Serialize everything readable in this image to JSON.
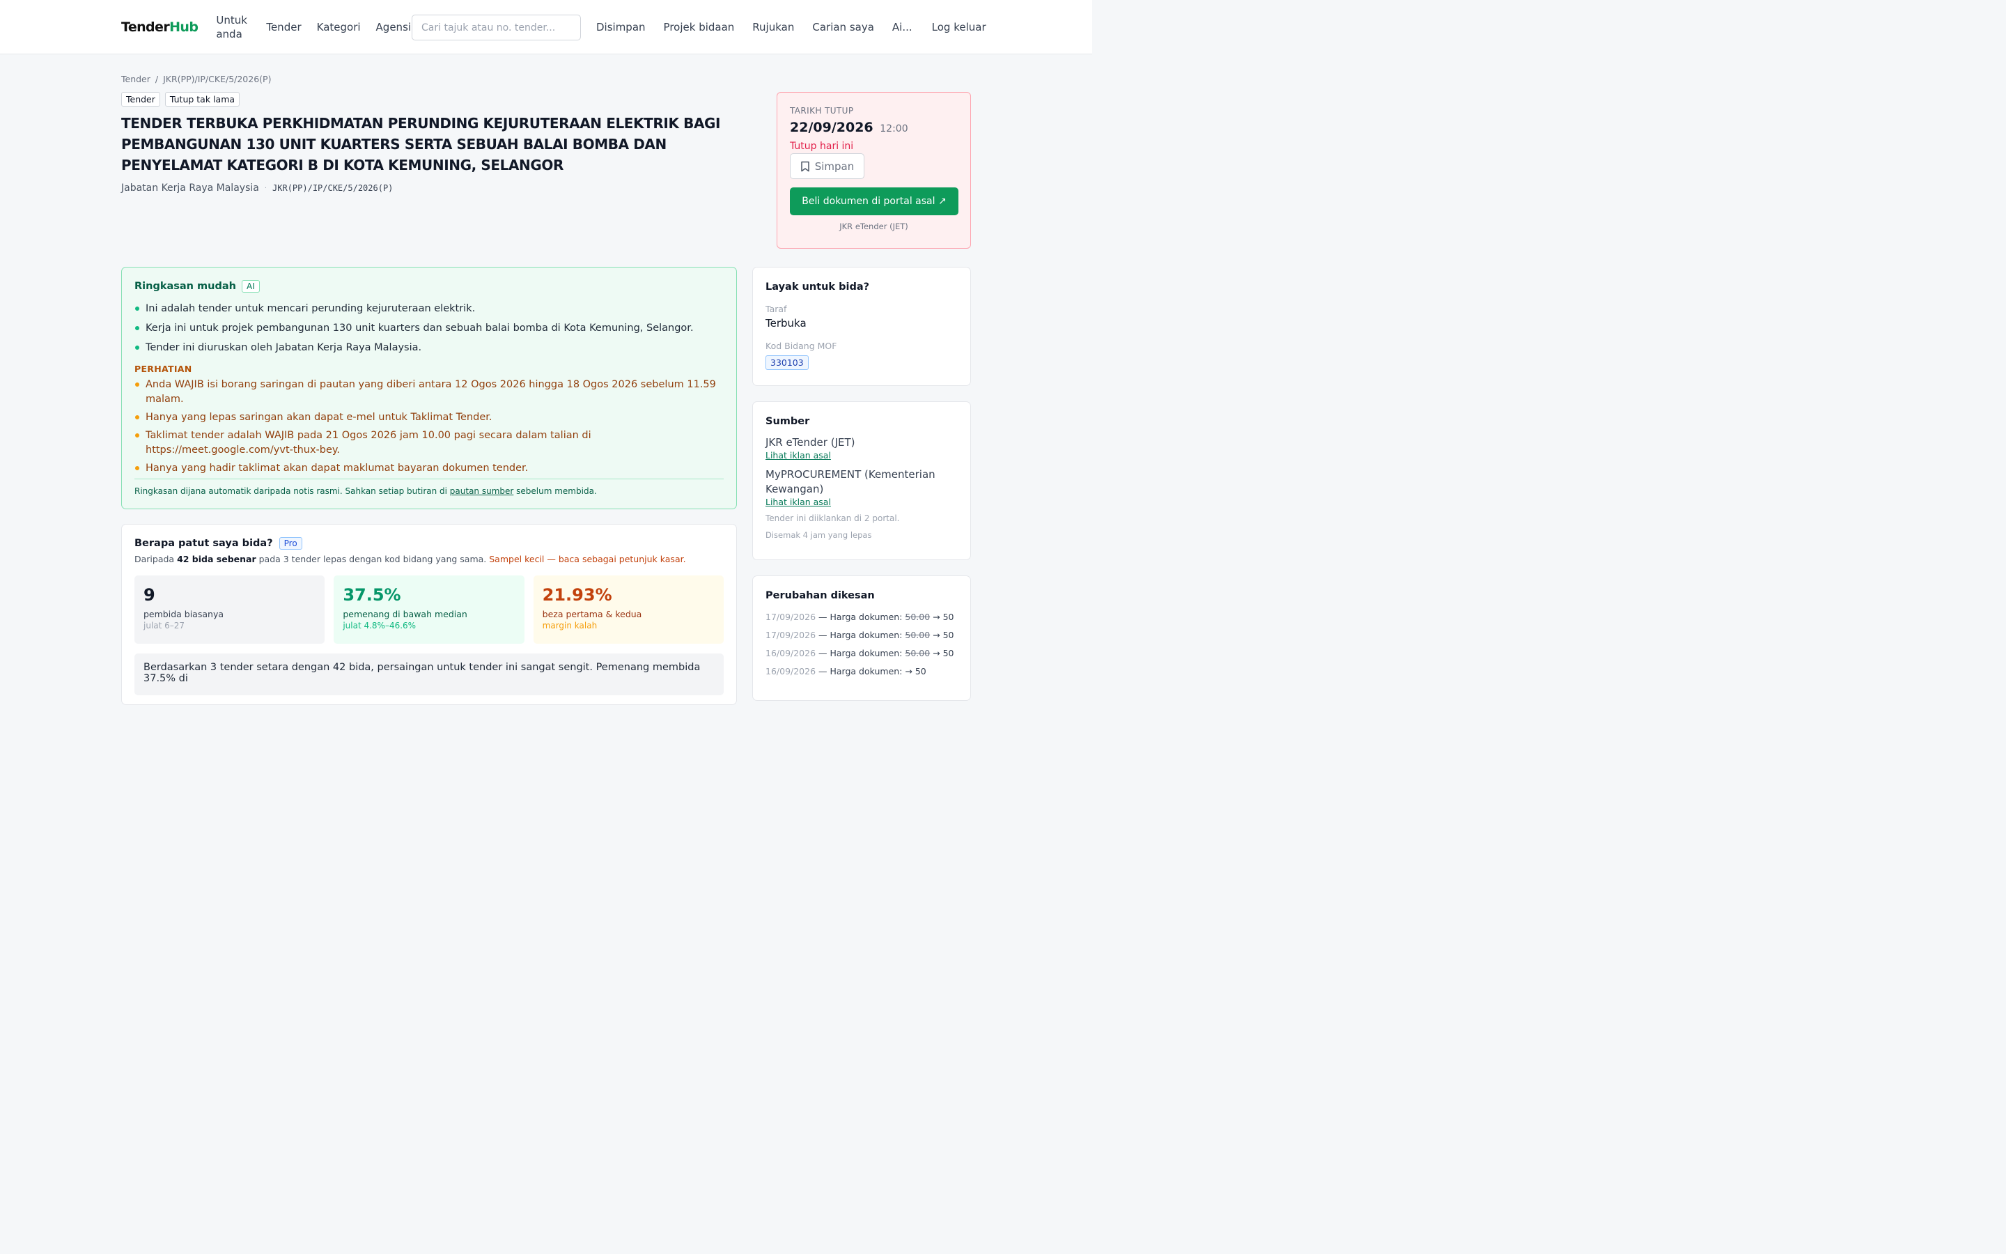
{
  "nav": {
    "logo_a": "Tender",
    "logo_b": "Hub",
    "for_you": "Untuk anda",
    "tender": "Tender",
    "category": "Kategori",
    "agency": "Agensi",
    "search_placeholder": "Cari tajuk atau no. tender...",
    "saved": "Disimpan",
    "bid_projects": "Projek bidaan",
    "referrals": "Rujukan",
    "my_searches": "Carian saya",
    "ai": "Ai...",
    "logout": "Log keluar"
  },
  "breadcrumb": {
    "root": "Tender",
    "sep": "/",
    "current": "JKR(PP)/IP/CKE/5/2026(P)"
  },
  "tags": [
    "Tender",
    "Tutup tak lama"
  ],
  "tender": {
    "title": "TENDER TERBUKA PERKHIDMATAN PERUNDING KEJURUTERAAN ELEKTRIK BAGI PEMBANGUNAN 130 UNIT KUARTERS SERTA SEBUAH BALAI BOMBA DAN PENYELAMAT KATEGORI B DI KOTA KEMUNING, SELANGOR",
    "agency": "Jabatan Kerja Raya Malaysia",
    "ref": "JKR(PP)/IP/CKE/5/2026(P)"
  },
  "closing": {
    "label": "TARIKH TUTUP",
    "date": "22/09/2026",
    "time": "12:00",
    "status": "Tutup hari ini",
    "save_label": "Simpan",
    "buy_label": "Beli dokumen di portal asal ↗",
    "portal": "JKR eTender (JET)"
  },
  "summary": {
    "title": "Ringkasan mudah",
    "badge": "AI",
    "points": [
      "Ini adalah tender untuk mencari perunding kejuruteraan elektrik.",
      "Kerja ini untuk projek pembangunan 130 unit kuarters dan sebuah balai bomba di Kota Kemuning, Selangor.",
      "Tender ini diuruskan oleh Jabatan Kerja Raya Malaysia."
    ],
    "warning_title": "PERHATIAN",
    "warnings": [
      "Anda WAJIB isi borang saringan di pautan yang diberi antara 12 Ogos 2026 hingga 18 Ogos 2026 sebelum 11.59 malam.",
      "Hanya yang lepas saringan akan dapat e-mel untuk Taklimat Tender.",
      "Taklimat tender adalah WAJIB pada 21 Ogos 2026 jam 10.00 pagi secara dalam talian di https://meet.google.com/yvt-thux-bey.",
      "Hanya yang hadir taklimat akan dapat maklumat bayaran dokumen tender."
    ],
    "footer_a": "Ringkasan dijana automatik daripada notis rasmi. Sahkan setiap butiran di ",
    "footer_link": "pautan sumber",
    "footer_b": " sebelum membida."
  },
  "bid": {
    "title": "Berapa patut saya bida?",
    "badge": "Pro",
    "desc_a": "Daripada ",
    "desc_b": "42 bida sebenar",
    "desc_c": " pada 3 tender lepas dengan kod bidang yang sama. ",
    "desc_d": "Sampel kecil — baca sebagai petunjuk kasar.",
    "stats": [
      {
        "value": "9",
        "label": "pembida biasanya",
        "sub": "julat 6–27"
      },
      {
        "value": "37.5%",
        "label": "pemenang di bawah median",
        "sub": "julat 4.8%–46.6%"
      },
      {
        "value": "21.93%",
        "label": "beza pertama & kedua",
        "sub": "margin kalah"
      }
    ],
    "explanation": "Berdasarkan 3 tender setara dengan 42 bida, persaingan untuk tender ini sangat sengit. Pemenang membida 37.5% di"
  },
  "eligibility": {
    "title": "Layak untuk bida?",
    "level_label": "Taraf",
    "level_value": "Terbuka",
    "mof_label": "Kod Bidang MOF",
    "mof_code": "330103"
  },
  "sources": {
    "title": "Sumber",
    "items": [
      {
        "name": "JKR eTender (JET)",
        "link": "Lihat iklan asal"
      },
      {
        "name": "MyPROCUREMENT (Kementerian Kewangan)",
        "link": "Lihat iklan asal"
      }
    ],
    "note": "Tender ini diiklankan di 2 portal.",
    "checked": "Disemak 4 jam yang lepas"
  },
  "changes": {
    "title": "Perubahan dikesan",
    "items": [
      {
        "date": "17/09/2026",
        "text": " — Harga dokumen: ",
        "old": "50.00",
        "new": " → 50"
      },
      {
        "date": "17/09/2026",
        "text": " — Harga dokumen: ",
        "old": "50.00",
        "new": " → 50"
      },
      {
        "date": "16/09/2026",
        "text": " — Harga dokumen: ",
        "old": "50.00",
        "new": " → 50"
      },
      {
        "date": "16/09/2026",
        "text": " — Harga dokumen: ",
        "old": "",
        "new": "→ 50"
      }
    ]
  }
}
